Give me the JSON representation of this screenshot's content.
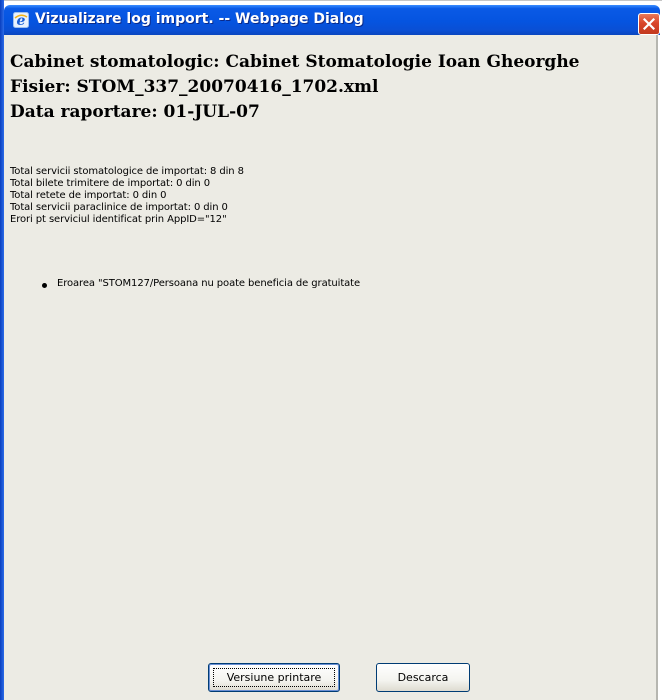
{
  "window": {
    "title": "Vizualizare log import. -- Webpage Dialog",
    "title_icon": "ie-icon",
    "close_icon": "close-icon",
    "close_color": "#d9452a",
    "titlebar_color": "#0554e0",
    "content_bg": "#ecebe4"
  },
  "header": {
    "cabinet": "Cabinet stomatologic: Cabinet Stomatologie Ioan Gheorghe",
    "fisier": "Fisier: STOM_337_20070416_1702.xml",
    "data": "Data raportare: 01-JUL-07"
  },
  "summary": {
    "lines": [
      "Total servicii stomatologice de importat: 8 din 8",
      "Total bilete trimitere de importat: 0 din 0",
      "Total retete de importat: 0 din 0",
      "Total servicii paraclinice de importat: 0 din 0",
      "Erori pt serviciul identificat prin AppID=\"12\""
    ]
  },
  "errors": {
    "items": [
      "Eroarea \"STOM127/Persoana nu poate beneficia de gratuitate"
    ]
  },
  "buttons": {
    "print_label": "Versiune printare",
    "download_label": "Descarca"
  }
}
